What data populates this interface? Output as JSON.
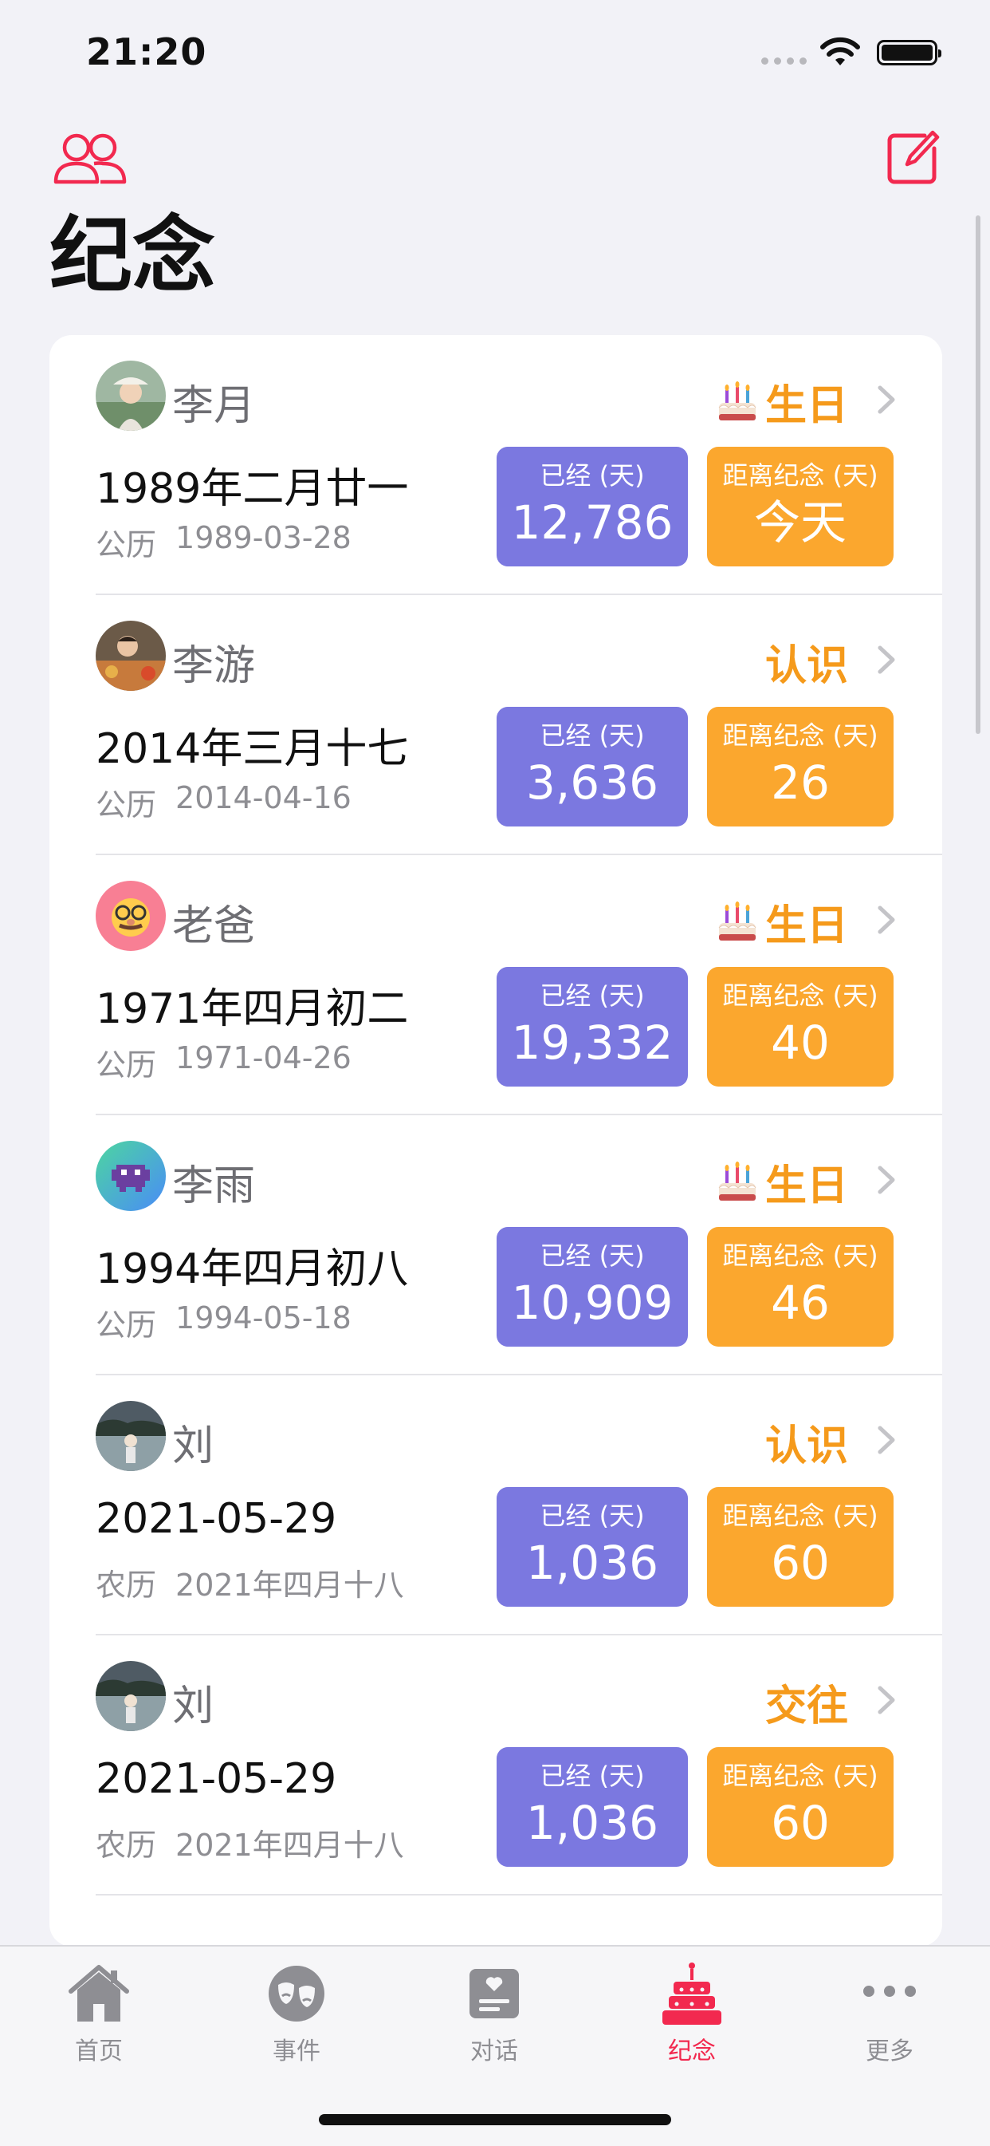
{
  "status_bar": {
    "time": "21:20"
  },
  "header": {
    "title": "纪念",
    "left_icon": "people-icon",
    "right_icon": "compose-icon"
  },
  "colors": {
    "accent": "#f2294f",
    "purple": "#7b78e0",
    "orange": "#fba72e",
    "tag": "#f59a1b"
  },
  "items": [
    {
      "name": "李月",
      "tag": "生日",
      "has_cake": true,
      "date_main": "1989年二月廿一",
      "calendar": "公历",
      "date_sub": "1989-03-28",
      "elapsed_label": "已经 (天)",
      "elapsed": "12,786",
      "until_label": "距离纪念 (天)",
      "until": "今天"
    },
    {
      "name": "李游",
      "tag": "认识",
      "has_cake": false,
      "date_main": "2014年三月十七",
      "calendar": "公历",
      "date_sub": "2014-04-16",
      "elapsed_label": "已经 (天)",
      "elapsed": "3,636",
      "until_label": "距离纪念 (天)",
      "until": "26"
    },
    {
      "name": "老爸",
      "tag": "生日",
      "has_cake": true,
      "date_main": "1971年四月初二",
      "calendar": "公历",
      "date_sub": "1971-04-26",
      "elapsed_label": "已经 (天)",
      "elapsed": "19,332",
      "until_label": "距离纪念 (天)",
      "until": "40"
    },
    {
      "name": "李雨",
      "tag": "生日",
      "has_cake": true,
      "date_main": "1994年四月初八",
      "calendar": "公历",
      "date_sub": "1994-05-18",
      "elapsed_label": "已经 (天)",
      "elapsed": "10,909",
      "until_label": "距离纪念 (天)",
      "until": "46"
    },
    {
      "name": "刘",
      "tag": "认识",
      "has_cake": false,
      "date_main": "2021-05-29",
      "calendar": "农历",
      "date_sub": "2021年四月十八",
      "elapsed_label": "已经 (天)",
      "elapsed": "1,036",
      "until_label": "距离纪念 (天)",
      "until": "60"
    },
    {
      "name": "刘",
      "tag": "交往",
      "has_cake": false,
      "date_main": "2021-05-29",
      "calendar": "农历",
      "date_sub": "2021年四月十八",
      "elapsed_label": "已经 (天)",
      "elapsed": "1,036",
      "until_label": "距离纪念 (天)",
      "until": "60"
    }
  ],
  "tabs": [
    {
      "label": "首页",
      "icon": "house-icon",
      "active": false
    },
    {
      "label": "事件",
      "icon": "theater-masks-icon",
      "active": false
    },
    {
      "label": "对话",
      "icon": "chat-card-icon",
      "active": false
    },
    {
      "label": "纪念",
      "icon": "birthday-cake-icon",
      "active": true
    },
    {
      "label": "更多",
      "icon": "more-dots-icon",
      "active": false
    }
  ]
}
